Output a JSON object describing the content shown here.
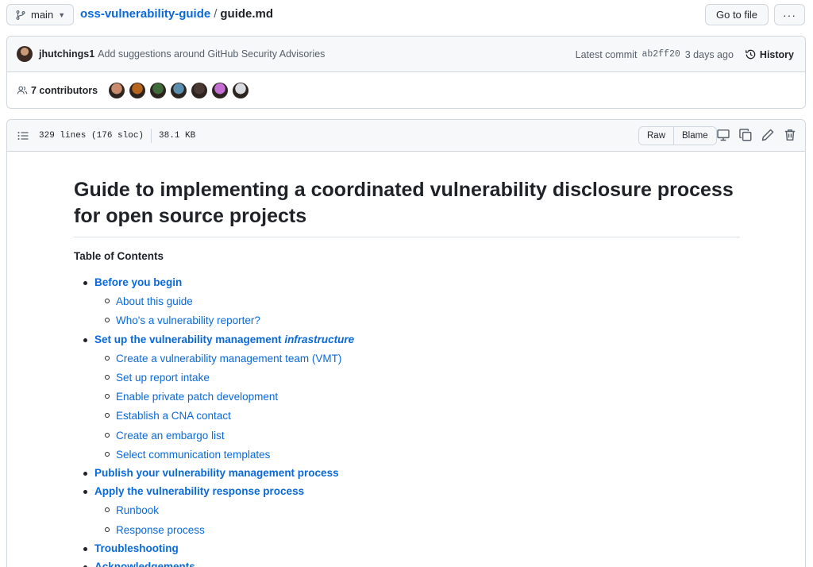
{
  "topbar": {
    "branch": "main",
    "repo": "oss-vulnerability-guide",
    "separator": "/",
    "file": "guide.md",
    "goto_file": "Go to file",
    "more": "···"
  },
  "commit": {
    "author": "jhutchings1",
    "message": "Add suggestions around GitHub Security Advisories",
    "latest_label": "Latest commit",
    "sha": "ab2ff20",
    "age": "3 days ago",
    "history_label": "History"
  },
  "contributors": {
    "count_label": "7 contributors",
    "avatar_colors": [
      "#c88b6e",
      "#b5651d",
      "#3f6b3a",
      "#5b8fb0",
      "#4a3a35",
      "#c56fd6",
      "#d8dbdf"
    ]
  },
  "file_header": {
    "lines": "329 lines (176 sloc)",
    "size": "38.1 KB",
    "raw": "Raw",
    "blame": "Blame"
  },
  "content": {
    "title": "Guide to implementing a coordinated vulnerability disclosure process for open source projects",
    "toc_heading": "Table of Contents",
    "toc": [
      {
        "label": "Before you begin",
        "children": [
          "About this guide",
          "Who's a vulnerability reporter?"
        ]
      },
      {
        "label_pre": "Set up the vulnerability management ",
        "label_em": "infrastructure",
        "children": [
          "Create a vulnerability management team (VMT)",
          "Set up report intake",
          "Enable private patch development",
          "Establish a CNA contact",
          "Create an embargo list",
          "Select communication templates"
        ]
      },
      {
        "label": "Publish your vulnerability management process",
        "children": []
      },
      {
        "label": "Apply the vulnerability response process",
        "children": [
          "Runbook",
          "Response process"
        ]
      },
      {
        "label": "Troubleshooting",
        "children": []
      },
      {
        "label": "Acknowledgements",
        "children": []
      }
    ]
  },
  "colors": {
    "link": "#0969da",
    "border": "#d0d7de",
    "header_bg": "#f6f8fa",
    "text": "#1f2328"
  }
}
